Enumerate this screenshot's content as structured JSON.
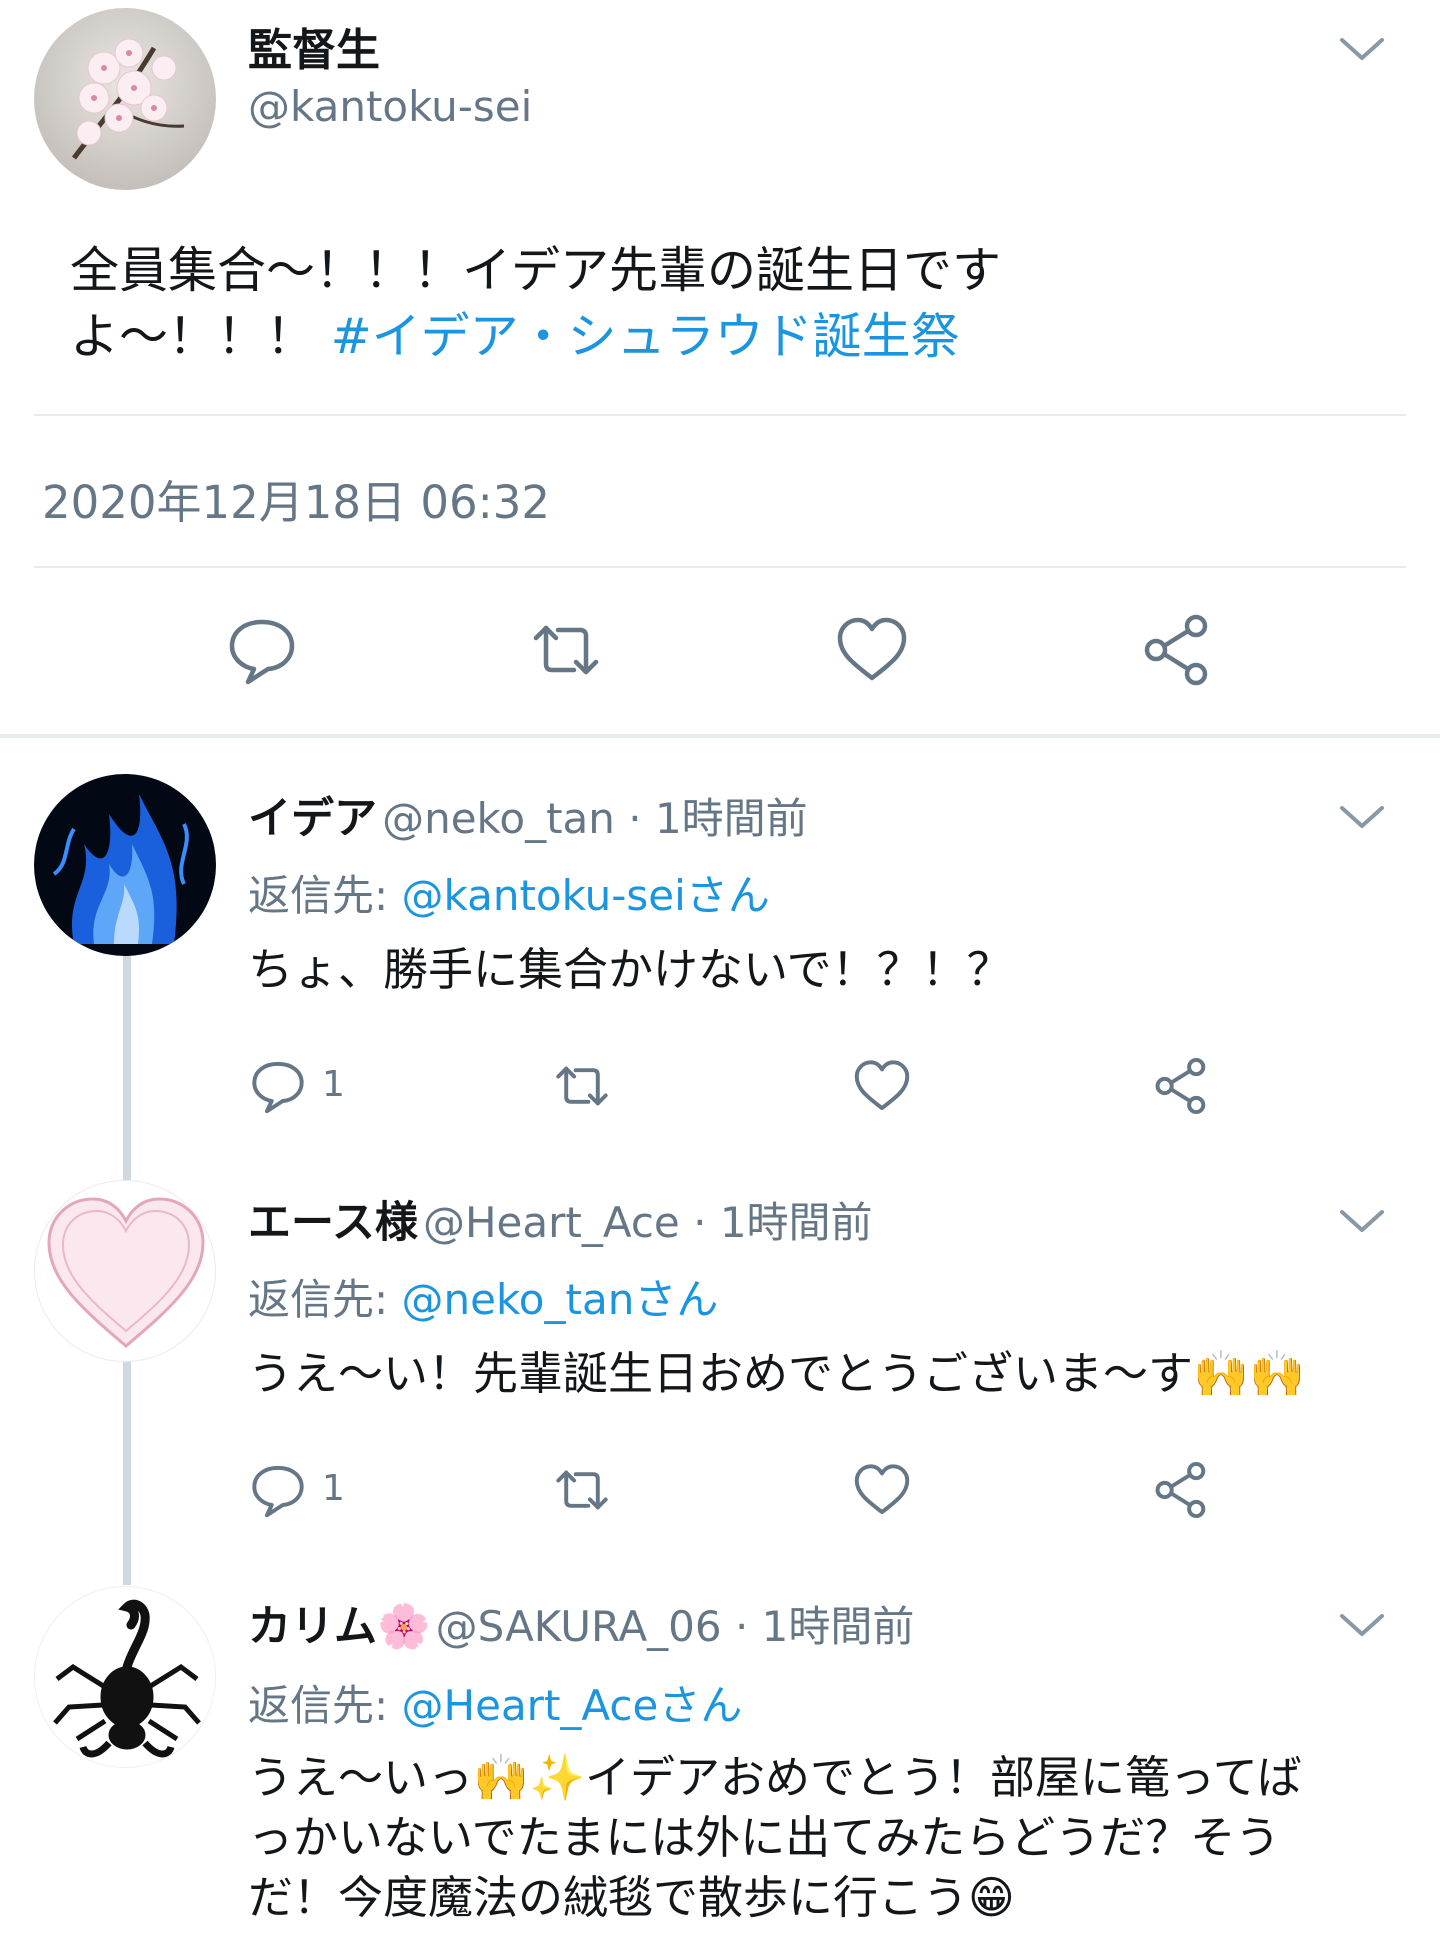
{
  "main_tweet": {
    "name": "監督生",
    "handle": "@kantoku-sei",
    "text_plain": "全員集合〜！！！イデア先輩の誕生日です\nよ〜！！！ ",
    "hashtag": "#イデア・シュラウド誕生祭",
    "timestamp": "2020年12月18日 06:32"
  },
  "replies": [
    {
      "name": "イデア",
      "meta": "@neko_tan · 1時間前",
      "reply_prefix": "返信先: ",
      "reply_to": "@kantoku-seiさん",
      "text": "ちょ、勝手に集合かけないで！？！？",
      "reply_count": "1"
    },
    {
      "name": "エース様",
      "meta": "@Heart_Ace · 1時間前",
      "reply_prefix": "返信先: ",
      "reply_to": "@neko_tanさん",
      "text": "うえ〜い！先輩誕生日おめでとうございま〜す🙌🙌",
      "reply_count": "1"
    },
    {
      "name": "カリム🌸",
      "meta": "@SAKURA_06 · 1時間前",
      "reply_prefix": "返信先: ",
      "reply_to": "@Heart_Aceさん",
      "text": "うえ〜いっ🙌✨イデアおめでとう！部屋に篭ってば\nっかいないでたまには外に出てみたらどうだ？そう\nだ！今度魔法の絨毯で散歩に行こう😁"
    }
  ],
  "colors": {
    "link": "#1b95e0",
    "secondary": "#657786",
    "icon": "#657786",
    "divider": "#e6ecf0"
  },
  "icons": [
    "chevron-down-icon",
    "reply-icon",
    "retweet-icon",
    "like-icon",
    "share-icon"
  ]
}
